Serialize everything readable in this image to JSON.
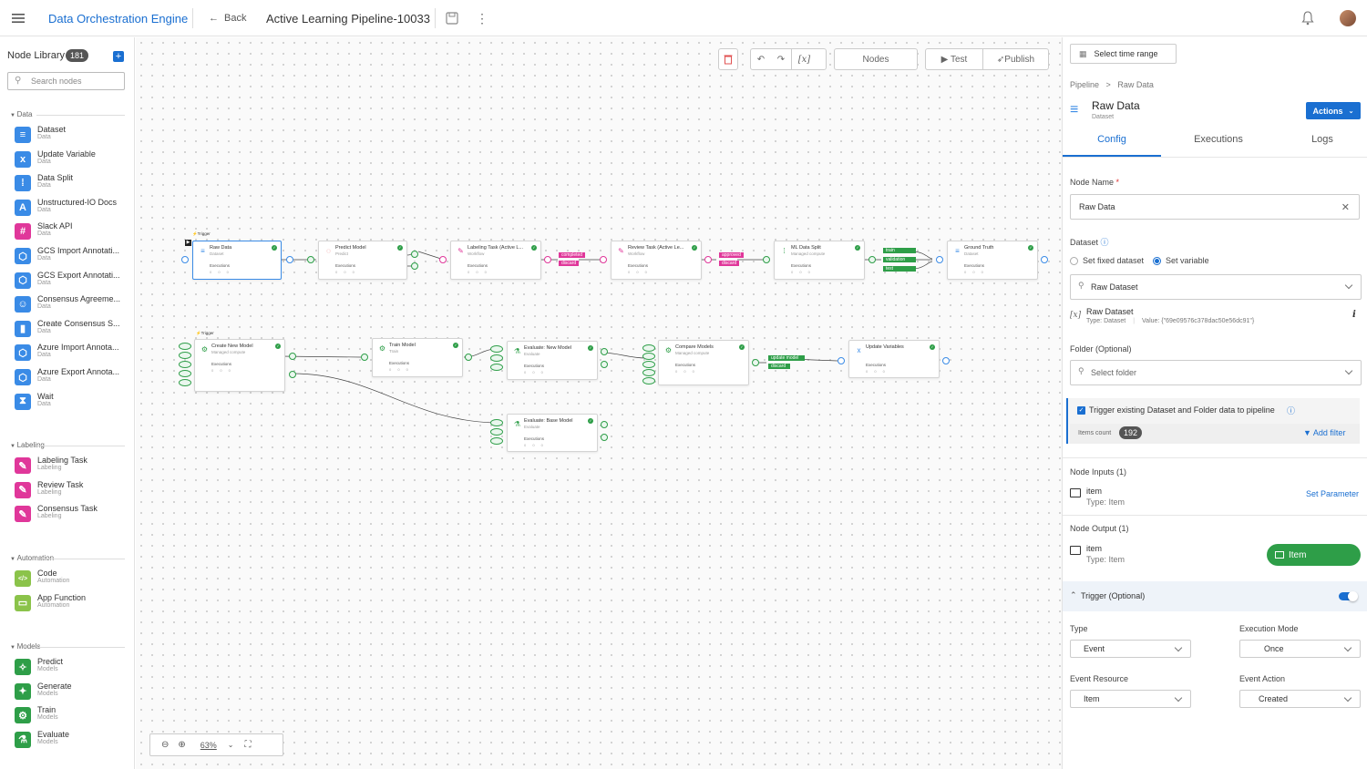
{
  "app": {
    "title": "Data Orchestration Engine",
    "back_label": "Back",
    "pipeline_name": "Active Learning Pipeline-10033"
  },
  "library": {
    "title": "Node Library",
    "count": "181",
    "search_placeholder": "Search nodes",
    "sections": [
      {
        "name": "Data",
        "items": [
          {
            "label": "Dataset",
            "sub": "Data",
            "color": "#3a8be6",
            "icon": "database-icon",
            "glyph": "≡"
          },
          {
            "label": "Update Variable",
            "sub": "Data",
            "color": "#3a8be6",
            "icon": "variable-icon",
            "glyph": "x"
          },
          {
            "label": "Data Split",
            "sub": "Data",
            "color": "#3a8be6",
            "icon": "split-icon",
            "glyph": "⁞"
          },
          {
            "label": "Unstructured-IO Docs",
            "sub": "Data",
            "color": "#3a8be6",
            "icon": "docs-icon",
            "glyph": "A"
          },
          {
            "label": "Slack API",
            "sub": "Data",
            "color": "#e0379a",
            "icon": "slack-icon",
            "glyph": "#"
          },
          {
            "label": "GCS Import Annotati...",
            "sub": "Data",
            "color": "#3a8be6",
            "icon": "gcs-import-icon",
            "glyph": "⬡"
          },
          {
            "label": "GCS Export Annotati...",
            "sub": "Data",
            "color": "#3a8be6",
            "icon": "gcs-export-icon",
            "glyph": "⬡"
          },
          {
            "label": "Consensus Agreeme...",
            "sub": "Data",
            "color": "#3a8be6",
            "icon": "consensus-icon",
            "glyph": "☺"
          },
          {
            "label": "Create Consensus S...",
            "sub": "Data",
            "color": "#3a8be6",
            "icon": "chart-icon",
            "glyph": "▮"
          },
          {
            "label": "Azure Import Annota...",
            "sub": "Data",
            "color": "#3a8be6",
            "icon": "azure-import-icon",
            "glyph": "⬡"
          },
          {
            "label": "Azure Export Annota...",
            "sub": "Data",
            "color": "#3a8be6",
            "icon": "azure-export-icon",
            "glyph": "⬡"
          },
          {
            "label": "Wait",
            "sub": "Data",
            "color": "#3a8be6",
            "icon": "hourglass-icon",
            "glyph": "⧗"
          }
        ]
      },
      {
        "name": "Labeling",
        "items": [
          {
            "label": "Labeling Task",
            "sub": "Labeling",
            "color": "#e0379a",
            "icon": "labeling-task-icon",
            "glyph": "✎"
          },
          {
            "label": "Review Task",
            "sub": "Labeling",
            "color": "#e0379a",
            "icon": "review-task-icon",
            "glyph": "✎"
          },
          {
            "label": "Consensus Task",
            "sub": "Labeling",
            "color": "#e0379a",
            "icon": "consensus-task-icon",
            "glyph": "✎"
          }
        ]
      },
      {
        "name": "Automation",
        "items": [
          {
            "label": "Code",
            "sub": "Automation",
            "color": "#8bc34a",
            "icon": "code-icon",
            "glyph": "</>"
          },
          {
            "label": "App Function",
            "sub": "Automation",
            "color": "#8bc34a",
            "icon": "app-function-icon",
            "glyph": "▭"
          }
        ]
      },
      {
        "name": "Models",
        "items": [
          {
            "label": "Predict",
            "sub": "Models",
            "color": "#2e9e48",
            "icon": "predict-icon",
            "glyph": "✧"
          },
          {
            "label": "Generate",
            "sub": "Models",
            "color": "#2e9e48",
            "icon": "generate-icon",
            "glyph": "✦"
          },
          {
            "label": "Train",
            "sub": "Models",
            "color": "#2e9e48",
            "icon": "train-icon",
            "glyph": "⚙"
          },
          {
            "label": "Evaluate",
            "sub": "Models",
            "color": "#2e9e48",
            "icon": "evaluate-icon",
            "glyph": "⚗"
          }
        ]
      }
    ]
  },
  "toolbar": {
    "nodes_label": "Nodes",
    "test_label": "Test",
    "publish_label": "Publish",
    "zoom": "63%"
  },
  "nodes": {
    "raw_data": {
      "title": "Raw Data",
      "sub": "Dataset",
      "ex": "Executions",
      "st": "0 0 0"
    },
    "predict_model": {
      "title": "Predict Model",
      "sub": "Predict",
      "ex": "Executions",
      "st": "0 0 0"
    },
    "labeling_task": {
      "title": "Labeling Task (Active L...",
      "sub": "Workflow",
      "ex": "Executions",
      "st": "0 0 0"
    },
    "review_task": {
      "title": "Review Task (Active Le...",
      "sub": "Workflow",
      "ex": "Executions",
      "st": "0 0 0"
    },
    "ml_split": {
      "title": "ML Data Split",
      "sub": "Managed compute",
      "ex": "Executions",
      "st": "0 0 0"
    },
    "ground_truth": {
      "title": "Ground Truth",
      "sub": "Dataset",
      "ex": "Executions",
      "st": "0 0 0"
    },
    "create_model": {
      "title": "Create New Model",
      "sub": "Managed compute",
      "ex": "Executions",
      "st": "0 0 0"
    },
    "train_model": {
      "title": "Train Model",
      "sub": "Train",
      "ex": "Executions",
      "st": "0 0 0"
    },
    "eval_new": {
      "title": "Evaluate: New Model",
      "sub": "Evaluate",
      "ex": "Executions",
      "st": "0 0 0"
    },
    "compare": {
      "title": "Compare Models",
      "sub": "Managed compute",
      "ex": "Executions",
      "st": "0 0 0"
    },
    "update_vars": {
      "title": "Update Variables",
      "sub": "",
      "ex": "Executions",
      "st": "0 0 0"
    },
    "eval_base": {
      "title": "Evaluate: Base Model",
      "sub": "Evaluate",
      "ex": "Executions",
      "st": "0 0 0"
    }
  },
  "tags": {
    "completed": "completed",
    "discard1": "discard",
    "approved": "approved",
    "discard2": "discard",
    "train": "train",
    "validation": "validation",
    "test": "test",
    "update_model": "update model",
    "discard3": "discard",
    "trigger1": "Trigger",
    "trigger2": "Trigger"
  },
  "panel": {
    "time_range": "Select time range",
    "breadcrumb_root": "Pipeline",
    "breadcrumb_sep": ">",
    "breadcrumb_current": "Raw Data",
    "node_title": "Raw Data",
    "node_sub": "Dataset",
    "actions_label": "Actions",
    "tabs": [
      "Config",
      "Executions",
      "Logs"
    ],
    "node_name_label": "Node Name",
    "required_mark": "*",
    "node_name_value": "Raw Data",
    "dataset_label": "Dataset",
    "radio_fixed": "Set fixed dataset",
    "radio_variable": "Set variable",
    "dataset_select": "Raw Dataset",
    "var_name": "Raw Dataset",
    "var_type": "Type: Dataset",
    "var_value": "Value: {\"69e09576c378dac50e56dc91\"}",
    "folder_label": "Folder (Optional)",
    "folder_placeholder": "Select folder",
    "trigger_existing": "Trigger existing Dataset and Folder data to pipeline",
    "items_count_label": "Items count",
    "items_count": "192",
    "add_filter": "Add filter",
    "node_inputs": "Node Inputs (1)",
    "input_name": "item",
    "input_type": "Type: Item",
    "set_parameter": "Set Parameter",
    "node_output": "Node Output (1)",
    "output_name": "item",
    "output_type": "Type: Item",
    "output_badge": "Item",
    "trigger_section": "Trigger (Optional)",
    "type_label": "Type",
    "type_value": "Event",
    "exec_mode_label": "Execution Mode",
    "exec_mode_value": "Once",
    "event_resource_label": "Event Resource",
    "event_resource_value": "Item",
    "event_action_label": "Event Action",
    "event_action_value": "Created"
  },
  "colors": {
    "accent": "#1a6fd1",
    "pink": "#e0379a",
    "green": "#2e9e48"
  }
}
